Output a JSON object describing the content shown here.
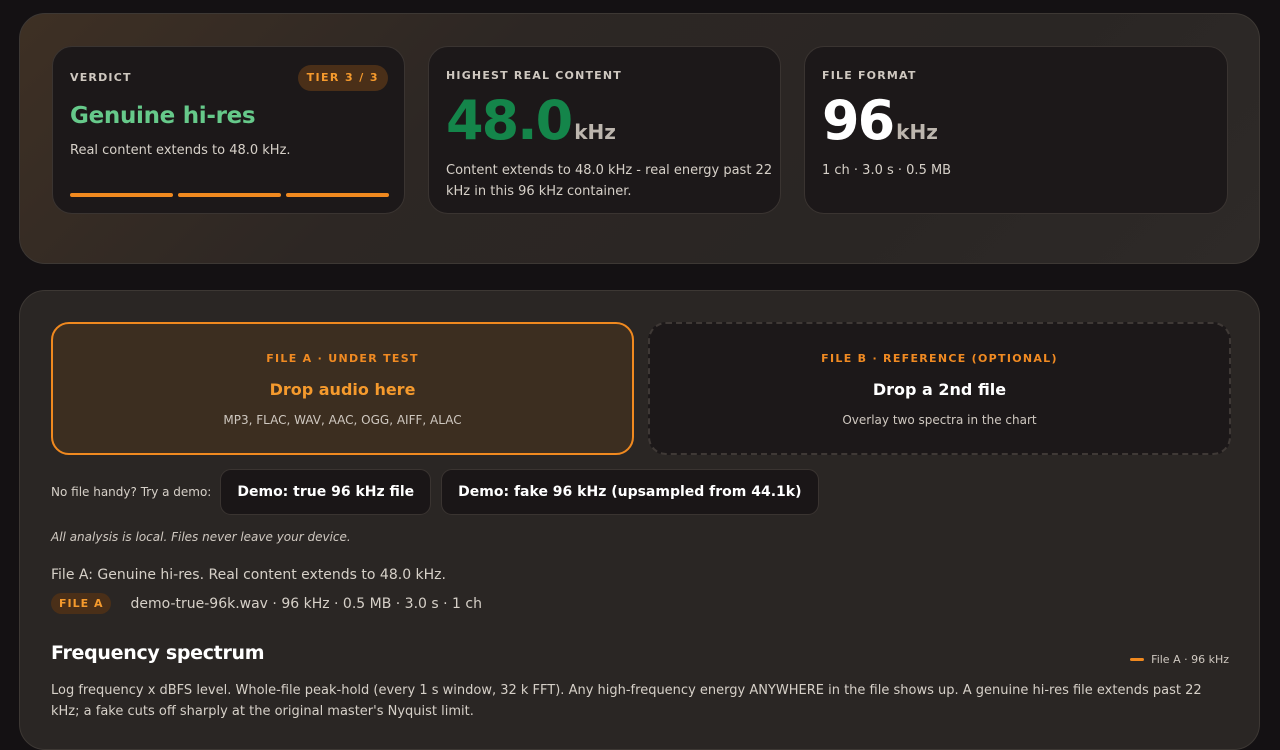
{
  "verdict": {
    "label": "VERDICT",
    "tier_badge": "TIER 3 / 3",
    "tier_level": 3,
    "tier_total": 3,
    "title": "Genuine hi-res",
    "description": "Real content extends to 48.0 kHz."
  },
  "real_content": {
    "label": "HIGHEST REAL CONTENT",
    "value": "48.0",
    "unit": "kHz",
    "description": "Content extends to 48.0 kHz - real energy past 22 kHz in this 96 kHz container."
  },
  "file_format": {
    "label": "FILE FORMAT",
    "value": "96",
    "unit": "kHz",
    "details": "1 ch · 3.0 s · 0.5 MB"
  },
  "dropzone_a": {
    "label": "FILE A · UNDER TEST",
    "title": "Drop audio here",
    "formats": "MP3, FLAC, WAV, AAC, OGG, AIFF, ALAC"
  },
  "dropzone_b": {
    "label": "FILE B · REFERENCE (OPTIONAL)",
    "title": "Drop a 2nd file",
    "subtitle": "Overlay two spectra in the chart"
  },
  "demo": {
    "prompt": "No file handy? Try a demo:",
    "true_button": "Demo: true 96 kHz file",
    "fake_button": "Demo: fake 96 kHz (upsampled from 44.1k)"
  },
  "privacy_note": "All analysis is local. Files never leave your device.",
  "result_summary": "File A: Genuine hi-res. Real content extends to 48.0 kHz.",
  "file_a": {
    "badge": "FILE A",
    "meta": "demo-true-96k.wav · 96 kHz · 0.5 MB · 3.0 s · 1 ch"
  },
  "spectrum": {
    "title": "Frequency spectrum",
    "legend": "File A · 96 kHz",
    "description": "Log frequency x dBFS level. Whole-file peak-hold (every 1 s window, 32 k FFT). Any high-frequency energy ANYWHERE in the file shows up. A genuine hi-res file extends past 22 kHz; a fake cuts off sharply at the original master's Nyquist limit."
  },
  "colors": {
    "accent": "#f0891f",
    "genuine_green": "#66c98a",
    "value_green": "#14854a"
  }
}
